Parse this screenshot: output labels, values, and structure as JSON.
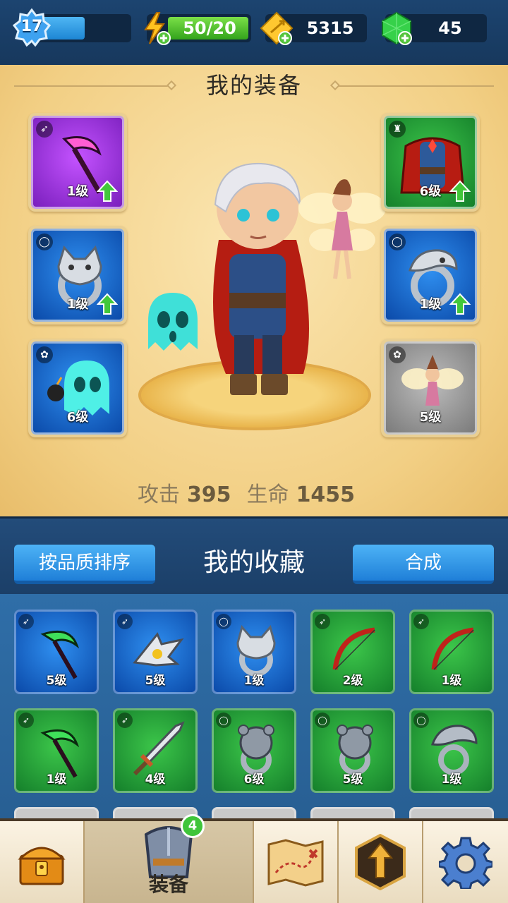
{
  "hud": {
    "level": "17",
    "xp_progress": 0.55,
    "energy": "50/20",
    "energy_progress": 1.0,
    "gold": "5315",
    "gems": "45"
  },
  "equipment": {
    "title": "我的装备",
    "slots": [
      {
        "name": "weapon-slot",
        "category": "bow",
        "item": "scythe",
        "quality": "purple",
        "level": "1级",
        "upgrade": true
      },
      {
        "name": "ring-slot-left",
        "category": "ring",
        "item": "wolf-ring",
        "quality": "blue",
        "level": "1级",
        "upgrade": true
      },
      {
        "name": "pet-slot-left",
        "category": "pet",
        "item": "ghost-bomber",
        "quality": "blue",
        "level": "6级",
        "upgrade": false
      },
      {
        "name": "armor-slot",
        "category": "armor",
        "item": "red-cape-armor",
        "quality": "green",
        "level": "6级",
        "upgrade": true
      },
      {
        "name": "ring-slot-right",
        "category": "ring",
        "item": "serpent-ring",
        "quality": "blue",
        "level": "1级",
        "upgrade": true
      },
      {
        "name": "pet-slot-right",
        "category": "pet",
        "item": "fairy",
        "quality": "gray",
        "level": "5级",
        "upgrade": false
      }
    ],
    "stats": {
      "attack_label": "攻击",
      "attack": "395",
      "hp_label": "生命",
      "hp": "1455"
    }
  },
  "collection": {
    "sort_button": "按品质排序",
    "title": "我的收藏",
    "merge_button": "合成",
    "items": [
      {
        "item": "scythe",
        "quality": "blue",
        "category": "bow",
        "level": "5级"
      },
      {
        "item": "shuriken",
        "quality": "blue",
        "category": "bow",
        "level": "5级"
      },
      {
        "item": "wolf-ring",
        "quality": "blue",
        "category": "ring",
        "level": "1级"
      },
      {
        "item": "red-bow",
        "quality": "green",
        "category": "bow",
        "level": "2级"
      },
      {
        "item": "red-bow",
        "quality": "green",
        "category": "bow",
        "level": "1级"
      },
      {
        "item": "scythe",
        "quality": "green",
        "category": "bow",
        "level": "1级"
      },
      {
        "item": "sword",
        "quality": "green",
        "category": "bow",
        "level": "4级"
      },
      {
        "item": "bear-ring",
        "quality": "green",
        "category": "ring",
        "level": "6级"
      },
      {
        "item": "bear-ring",
        "quality": "green",
        "category": "ring",
        "level": "5级"
      },
      {
        "item": "serpent-ring",
        "quality": "green",
        "category": "ring",
        "level": "1级"
      }
    ]
  },
  "nav": {
    "items": [
      {
        "name": "shop",
        "icon": "treasure-chest-icon"
      },
      {
        "name": "equipment",
        "icon": "armor-icon",
        "label": "装备",
        "badge": "4",
        "active": true
      },
      {
        "name": "map",
        "icon": "treasure-map-icon"
      },
      {
        "name": "upgrade",
        "icon": "upgrade-arrow-icon"
      },
      {
        "name": "settings",
        "icon": "gear-icon"
      }
    ]
  },
  "colors": {
    "purple": "#9b34e0",
    "blue": "#1e6fd1",
    "green": "#28a23a",
    "gray": "#9a9a9a",
    "accent_blue": "#2f8be6"
  }
}
